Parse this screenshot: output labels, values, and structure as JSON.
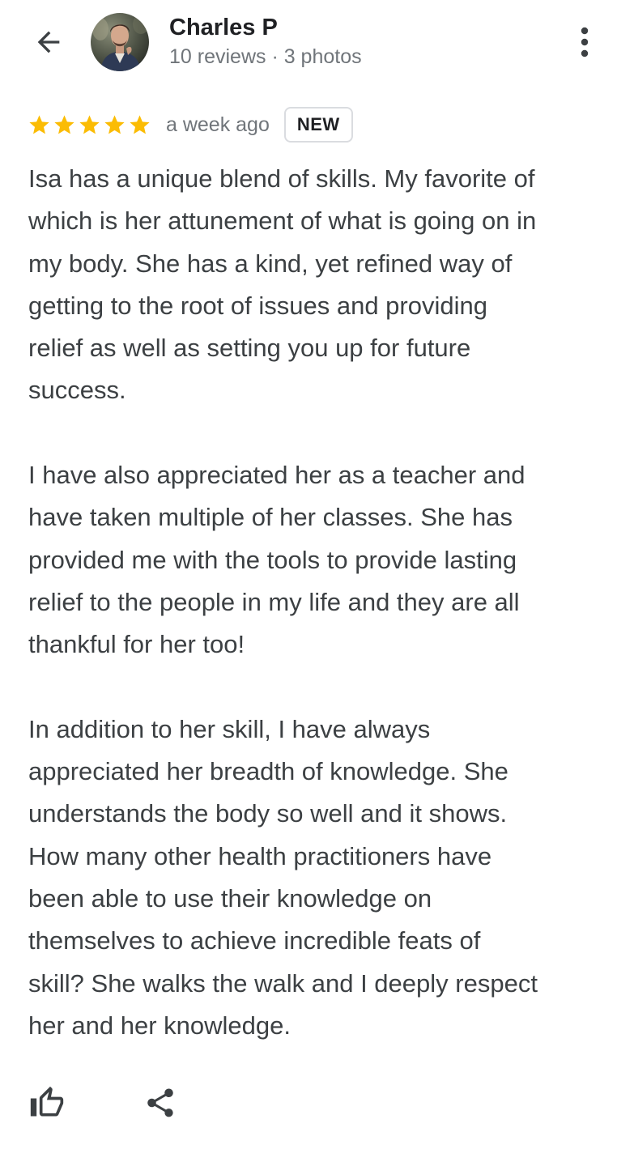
{
  "reviewer": {
    "name": "Charles P",
    "meta": "10 reviews · 3 photos"
  },
  "review": {
    "rating": 5,
    "max_rating": 5,
    "time_ago": "a week ago",
    "badge": "NEW",
    "paragraphs": [
      "Isa has a unique blend of skills. My favorite of\nwhich is her attunement of what is going on in\nmy body. She has a kind, yet refined way of\ngetting to the root of issues and providing\nrelief as well as setting you up for future\nsuccess.",
      "I have also appreciated her as a teacher and\nhave taken multiple of her classes. She has\nprovided me with the tools to provide lasting\nrelief to the people in my life and they are all\nthankful for her too!",
      "In addition to her skill, I have always\nappreciated her breadth of knowledge. She\nunderstands the body so well and it shows.\nHow many other health practitioners have\nbeen able to use their knowledge on\nthemselves to achieve incredible feats of\nskill? She walks the walk and I deeply respect\nher and her knowledge."
    ]
  },
  "icons": {
    "back": "arrow-back-icon",
    "more": "more-vert-icon",
    "star": "star-icon",
    "like": "thumb-up-icon",
    "share": "share-icon"
  },
  "colors": {
    "star": "#fbbc04",
    "text": "#3c4043",
    "secondary": "#70757a",
    "title": "#202124"
  }
}
